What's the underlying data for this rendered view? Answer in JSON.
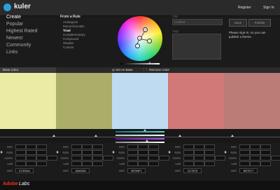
{
  "app": {
    "title": "kuler"
  },
  "header": {
    "register": "Register",
    "sign_in": "Sign In"
  },
  "nav": [
    "Create",
    "Popular",
    "Highest Rated",
    "Newest",
    "Community",
    "Links"
  ],
  "rules": {
    "title": "From a Rule",
    "items": [
      "Analogous",
      "Monochromatic",
      "Triad",
      "Complementary",
      "Compound",
      "Shades",
      "Custom"
    ],
    "active": "Triad"
  },
  "theme": {
    "title_label": "Title",
    "title_value": "Untitled",
    "tags_label": "Tags",
    "save_label": "Save",
    "publish_label": "Publish",
    "signin_message": "Please sign-in, so you can publish a theme."
  },
  "toolbar": {
    "base_color": "Base Color",
    "set_as_base": "Set As Base",
    "remove_color": "Remove Color"
  },
  "swatches": [
    {
      "hex": "#ECEBA5",
      "hsv": [
        "",
        "",
        ""
      ],
      "rgb": [
        "",
        "",
        ""
      ],
      "cmyk": [
        "",
        "",
        "",
        ""
      ],
      "lab": [
        "",
        "",
        ""
      ],
      "hex_label": "ECEBA5"
    },
    {
      "hex": "#ABAE68",
      "hsv": [
        "",
        "",
        ""
      ],
      "rgb": [
        "",
        "",
        ""
      ],
      "cmyk": [
        "",
        "",
        "",
        ""
      ],
      "lab": [
        "",
        "",
        ""
      ],
      "hex_label": "ABAE68"
    },
    {
      "hex": "#BFDBF1",
      "hsv": [
        "",
        "",
        ""
      ],
      "rgb": [
        "",
        "",
        ""
      ],
      "cmyk": [
        "",
        "",
        "",
        ""
      ],
      "lab": [
        "",
        "",
        ""
      ],
      "hex_label": "BFDBF1"
    },
    {
      "hex": "#D17878",
      "hsv": [
        "",
        "",
        ""
      ],
      "rgb": [
        "",
        "",
        ""
      ],
      "cmyk": [
        "",
        "",
        "",
        ""
      ],
      "lab": [
        "",
        "",
        ""
      ],
      "hex_label": "D17878"
    },
    {
      "hex": "#BB7B77",
      "hsv": [
        "",
        "",
        ""
      ],
      "rgb": [
        "",
        "",
        ""
      ],
      "cmyk": [
        "",
        "",
        "",
        ""
      ],
      "lab": [
        "",
        "",
        ""
      ],
      "hex_label": "BB7B77"
    }
  ],
  "value_labels": {
    "hsv": "HSV",
    "rgb": "RGB",
    "cmyk": "CMYK",
    "lab": "LAB",
    "hex": "HEX"
  },
  "footer": {
    "adobe": "Adobe",
    "labs": "Labs"
  },
  "colors": {
    "accent": "#2aa0d6",
    "background": "#1b1b1b",
    "adobe_red": "#e33322"
  }
}
